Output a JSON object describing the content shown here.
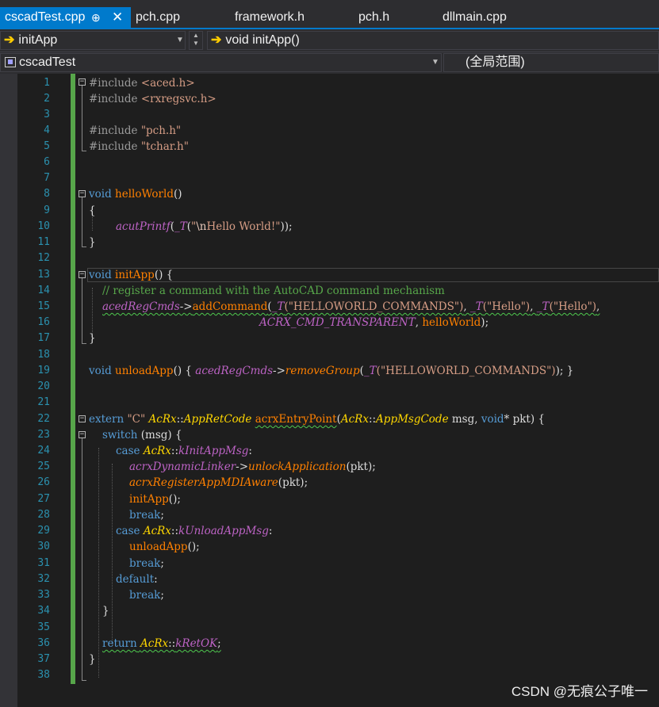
{
  "tabs": [
    {
      "label": "cscadTest.cpp",
      "active": true,
      "pin": "⊕",
      "close": "✕"
    },
    {
      "label": "pch.cpp"
    },
    {
      "label": "framework.h"
    },
    {
      "label": "pch.h"
    },
    {
      "label": "dllmain.cpp"
    }
  ],
  "nav": {
    "member_dropdown": "initApp",
    "function_dropdown": "void initApp()",
    "project_dropdown": "cscadTest",
    "scope_dropdown": "(全局范围)"
  },
  "editor": {
    "line_numbers": [
      "1",
      "2",
      "3",
      "4",
      "5",
      "6",
      "7",
      "8",
      "9",
      "10",
      "11",
      "12",
      "13",
      "14",
      "15",
      "16",
      "17",
      "18",
      "19",
      "20",
      "21",
      "22",
      "23",
      "24",
      "25",
      "26",
      "27",
      "28",
      "29",
      "30",
      "31",
      "32",
      "33",
      "34",
      "35",
      "36",
      "37",
      "38"
    ],
    "code": {
      "l1_kw": "#include",
      "l1_rest": " <aced.h>",
      "l2_kw": "#include",
      "l2_rest": " <rxregsvc.h>",
      "l4_kw": "#include",
      "l4_rest": " \"pch.h\"",
      "l5_kw": "#include",
      "l5_rest": " \"tchar.h\"",
      "l8_void": "void",
      "l8_fn": "helloWorld",
      "l8_rest": "()",
      "l9": "{",
      "l10_mac": "acutPrintf",
      "l10_a": "(",
      "l10_t": "_T",
      "l10_b": "(",
      "l10_q1": "\"",
      "l10_esc": "\\n",
      "l10_s": "Hello World!\"",
      "l10_c": "));",
      "l11": "}",
      "l13_void": "void",
      "l13_fn": "initApp",
      "l13_rest": "() {",
      "l14": "// register a command with the AutoCAD command mechanism",
      "l15_glb": "acedRegCmds",
      "l15_arrow": "->",
      "l15_fn": "addCommand",
      "l15_a": "(",
      "l15_t1": "_T",
      "l15_s1": "(\"HELLOWORLD_COMMANDS\")",
      "l15_c1": ", ",
      "l15_t2": "_T",
      "l15_s2": "(\"Hello\")",
      "l15_c2": ", ",
      "l15_t3": "_T",
      "l15_s3": "(\"Hello\")",
      "l15_c3": ",",
      "l16_mac": "ACRX_CMD_TRANSPARENT",
      "l16_c": ", ",
      "l16_fn": "helloWorld",
      "l16_e": ");",
      "l17": "}",
      "l19_void": "void",
      "l19_fn": "unloadApp",
      "l19_a": "() { ",
      "l19_glb": "acedRegCmds",
      "l19_arrow": "->",
      "l19_fn2": "removeGroup",
      "l19_b": "(",
      "l19_t": "_T",
      "l19_s": "(\"HELLOWORLD_COMMANDS\")",
      "l19_e": "); }",
      "l22_kw": "extern",
      "l22_sp1": " ",
      "l22_str": "\"C\"",
      "l22_sp2": " ",
      "l22_cls": "AcRx",
      "l22_dc": "::",
      "l22_cls2": "AppRetCode",
      "l22_sp3": " ",
      "l22_fn": "acrxEntryPoint",
      "l22_a": "(",
      "l22_cls3": "AcRx",
      "l22_dc2": "::",
      "l22_cls4": "AppMsgCode",
      "l22_p1": " msg, ",
      "l22_void": "void",
      "l22_p2": "* pkt) {",
      "l23_kw": "switch",
      "l23_rest": " (msg) {",
      "l24_kw": "case",
      "l24_sp": " ",
      "l24_cls": "AcRx",
      "l24_dc": "::",
      "l24_mac": "kInitAppMsg",
      "l24_e": ":",
      "l25_glb": "acrxDynamicLinker",
      "l25_arrow": "->",
      "l25_fn": "unlockApplication",
      "l25_e": "(pkt);",
      "l26_fn": "acrxRegisterAppMDIAware",
      "l26_e": "(pkt);",
      "l27_fn": "initApp",
      "l27_e": "();",
      "l28_kw": "break",
      "l28_e": ";",
      "l29_kw": "case",
      "l29_sp": " ",
      "l29_cls": "AcRx",
      "l29_dc": "::",
      "l29_mac": "kUnloadAppMsg",
      "l29_e": ":",
      "l30_fn": "unloadApp",
      "l30_e": "();",
      "l31_kw": "break",
      "l31_e": ";",
      "l32_kw": "default",
      "l32_e": ":",
      "l33_kw": "break",
      "l33_e": ";",
      "l34": "}",
      "l36_kw": "return",
      "l36_sp": " ",
      "l36_cls": "AcRx",
      "l36_dc": "::",
      "l36_mac": "kRetOK",
      "l36_e": ";",
      "l37": "}"
    }
  },
  "watermark": "CSDN @无痕公子唯一",
  "colors": {
    "accent": "#007acc",
    "background": "#1e1e1e",
    "keyword": "#569cd6",
    "function": "#ff8000",
    "string": "#d69d85",
    "comment": "#57a64a",
    "line_number": "#2b91af",
    "change_bar": "#57a64a"
  },
  "icons": [
    "pin-icon",
    "close-icon",
    "arrow-icon",
    "chevron-down-icon",
    "project-icon",
    "fold-icon"
  ]
}
